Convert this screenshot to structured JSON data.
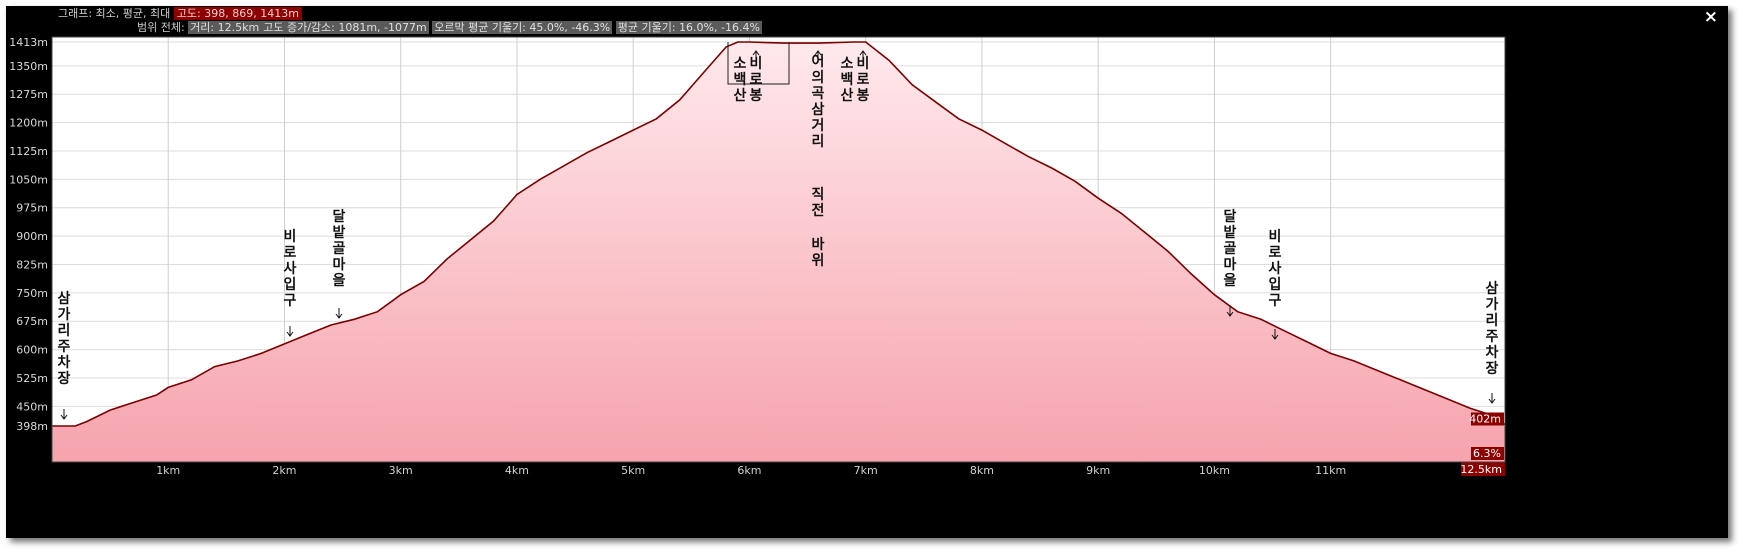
{
  "header": {
    "line1_label": "그래프: 최소, 평균, 최대",
    "line1_values": "고도: 398, 869, 1413m",
    "line2_label": "범위 전체:",
    "line2_distance": "거리: 12.5km",
    "line2_elev": "고도 증가/감소: 1081m, -1077m",
    "line2_up": "오르막 평균 기울기: 45.0%, -46.3%",
    "line2_grade": "평균 기울기: 16.0%, -16.4%",
    "close_label": "×"
  },
  "colors": {
    "line": "#7a0000",
    "fill_top": "#ffe9ec",
    "fill_bottom": "#f6a3ad",
    "badge": "#8c0000"
  },
  "badges": {
    "end_elev": "402m",
    "end_grade": "6.3%",
    "end_dist": "12.5km"
  },
  "chart_data": {
    "type": "area",
    "xlabel": "",
    "ylabel": "",
    "xlim": [
      0,
      12.5
    ],
    "ylim": [
      398,
      1413
    ],
    "ytick_labels": [
      "1413m",
      "1350m",
      "1275m",
      "1200m",
      "1125m",
      "1050m",
      "975m",
      "900m",
      "825m",
      "750m",
      "675m",
      "600m",
      "525m",
      "450m",
      "398m"
    ],
    "ytick_values": [
      1413,
      1350,
      1275,
      1200,
      1125,
      1050,
      975,
      900,
      825,
      750,
      675,
      600,
      525,
      450,
      398
    ],
    "xtick_labels": [
      "1km",
      "2km",
      "3km",
      "4km",
      "5km",
      "6km",
      "7km",
      "8km",
      "9km",
      "10km",
      "11km",
      "12.5km"
    ],
    "xtick_values": [
      1,
      2,
      3,
      4,
      5,
      6,
      7,
      8,
      9,
      10,
      11,
      12.5
    ],
    "grid": true,
    "series": [
      {
        "x": [
          0,
          0.2,
          0.3,
          0.5,
          0.7,
          0.9,
          1.0,
          1.2,
          1.4,
          1.6,
          1.8,
          2.0,
          2.2,
          2.4,
          2.6,
          2.8,
          3.0,
          3.2,
          3.4,
          3.6,
          3.8,
          4.0,
          4.2,
          4.4,
          4.6,
          4.8,
          5.0,
          5.2,
          5.4,
          5.6,
          5.8,
          5.9,
          6.0,
          6.3,
          6.6,
          6.9,
          7.0,
          7.2,
          7.4,
          7.6,
          7.8,
          8.0,
          8.2,
          8.4,
          8.6,
          8.8,
          9.0,
          9.2,
          9.4,
          9.6,
          9.8,
          10.0,
          10.2,
          10.4,
          10.6,
          10.8,
          11.0,
          11.2,
          11.4,
          11.6,
          11.8,
          12.0,
          12.2,
          12.35,
          12.5
        ],
        "y": [
          398,
          398,
          410,
          440,
          460,
          480,
          500,
          520,
          555,
          570,
          590,
          615,
          640,
          665,
          680,
          700,
          745,
          780,
          840,
          890,
          940,
          1010,
          1050,
          1085,
          1120,
          1150,
          1180,
          1210,
          1260,
          1330,
          1400,
          1413,
          1413,
          1410,
          1410,
          1413,
          1413,
          1365,
          1300,
          1255,
          1210,
          1180,
          1145,
          1110,
          1080,
          1045,
          1000,
          960,
          910,
          860,
          800,
          745,
          700,
          680,
          650,
          620,
          590,
          570,
          545,
          520,
          495,
          470,
          445,
          430,
          402
        ]
      }
    ],
    "annotations": [
      {
        "text": "삼가리주차장",
        "x": 0.08,
        "y": 398
      },
      {
        "text": "비로사입구",
        "x": 2.05,
        "y": 615
      },
      {
        "text": "달밭골마을",
        "x": 2.5,
        "y": 680
      },
      {
        "text": "비로봉",
        "x": 6.08,
        "y": 1413
      },
      {
        "text": "소백산",
        "x": 6.08,
        "y": 1413
      },
      {
        "text": "어의곡삼거리",
        "x": 6.6,
        "y": 1410
      },
      {
        "text": "직전",
        "x": 6.6,
        "y": 1410
      },
      {
        "text": "바위",
        "x": 6.6,
        "y": 1410
      },
      {
        "text": "비로봉",
        "x": 6.97,
        "y": 1413
      },
      {
        "text": "소백산",
        "x": 6.97,
        "y": 1413
      },
      {
        "text": "달밭골마을",
        "x": 10.15,
        "y": 700
      },
      {
        "text": "비로사입구",
        "x": 10.5,
        "y": 650
      },
      {
        "text": "삼가리주차장",
        "x": 12.4,
        "y": 425
      }
    ]
  }
}
